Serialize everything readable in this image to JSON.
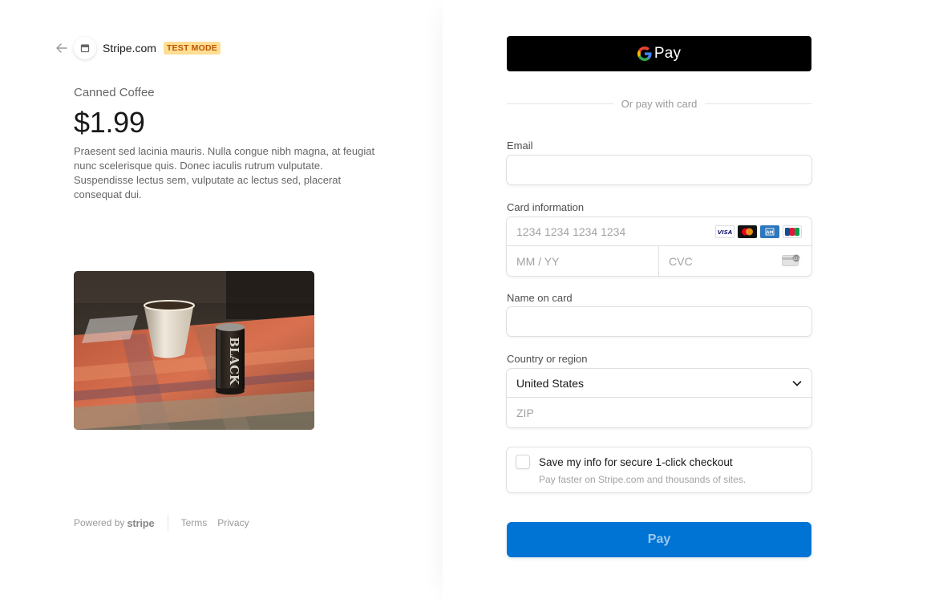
{
  "merchant": {
    "name": "Stripe.com",
    "mode_badge": "TEST MODE"
  },
  "product": {
    "name": "Canned Coffee",
    "price": "$1.99",
    "description": "Praesent sed lacinia mauris. Nulla congue nibh magna, at feugiat nunc scelerisque quis. Donec iaculis rutrum vulputate. Suspendisse lectus sem, vulputate ac lectus sed, placerat consequat dui.",
    "image_text": "BLACK"
  },
  "footer": {
    "powered_by": "Powered by",
    "stripe": "stripe",
    "terms": "Terms",
    "privacy": "Privacy"
  },
  "wallet": {
    "label": "Pay"
  },
  "divider_text": "Or pay with card",
  "form": {
    "email_label": "Email",
    "email_value": "",
    "card_label": "Card information",
    "card_number_placeholder": "1234 1234 1234 1234",
    "expiry_placeholder": "MM / YY",
    "cvc_placeholder": "CVC",
    "card_brands": [
      "VISA",
      "Mastercard",
      "AMEX",
      "JCB"
    ],
    "name_label": "Name on card",
    "name_value": "",
    "country_label": "Country or region",
    "country_value": "United States",
    "zip_placeholder": "ZIP"
  },
  "save_info": {
    "title": "Save my info for secure 1-click checkout",
    "subtitle": "Pay faster on Stripe.com and thousands of sites.",
    "checked": false
  },
  "pay_button": "Pay",
  "colors": {
    "accent": "#0074d4",
    "badge_bg": "#ffde92",
    "badge_text": "#bb5504"
  }
}
